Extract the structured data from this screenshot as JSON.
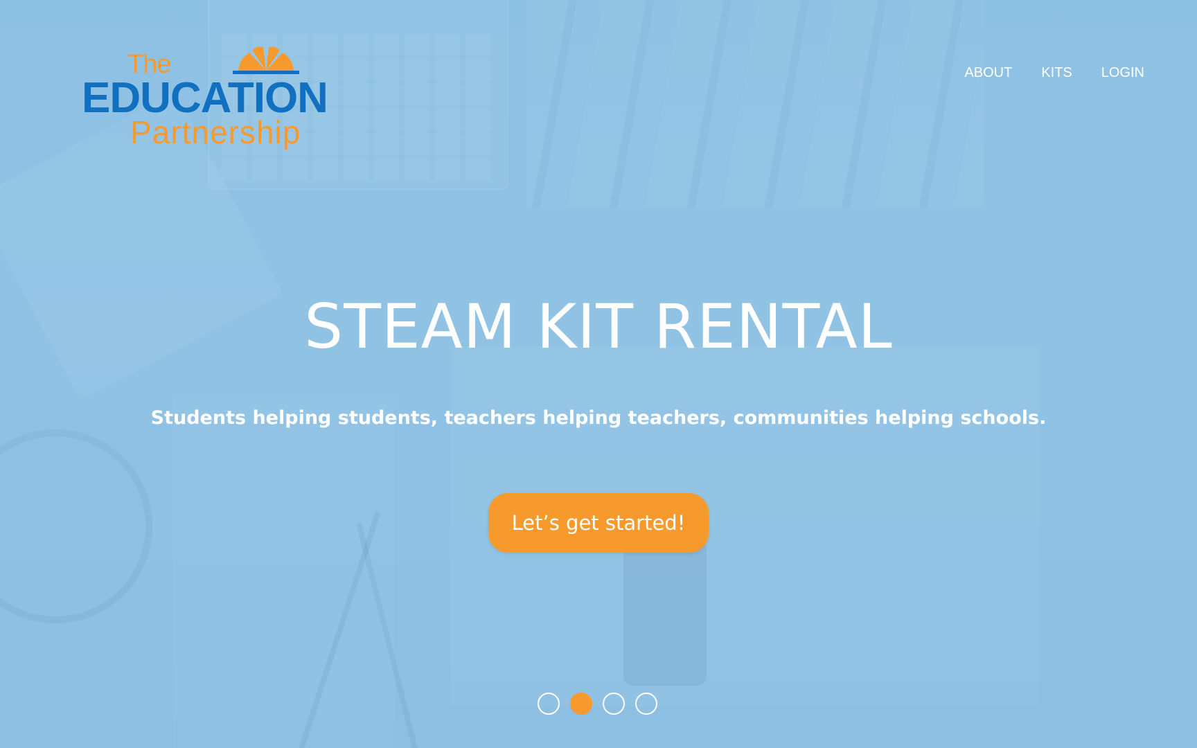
{
  "logo": {
    "line1": "The",
    "line2": "EDUCATION",
    "line3": "Partnership"
  },
  "nav": {
    "items": [
      {
        "label": "ABOUT"
      },
      {
        "label": "KITS"
      },
      {
        "label": "LOGIN"
      }
    ]
  },
  "hero": {
    "title": "STEAM KIT RENTAL",
    "subtitle": "Students helping students, teachers helping teachers, communities helping schools.",
    "cta_label": "Let’s get started!"
  },
  "carousel": {
    "slide_count": 4,
    "active_index": 1
  },
  "colors": {
    "overlay_blue": "#8ec1e3",
    "brand_orange": "#f79a2e",
    "brand_blue": "#1170bf"
  }
}
